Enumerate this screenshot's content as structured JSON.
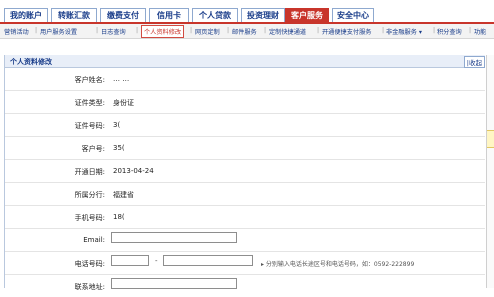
{
  "tabs": [
    {
      "label": "我的账户",
      "active": false
    },
    {
      "label": "转账汇款",
      "active": false
    },
    {
      "label": "缴费支付",
      "active": false
    },
    {
      "label": "信用卡",
      "active": false
    },
    {
      "label": "个人贷款",
      "active": false
    },
    {
      "label": "投资理财",
      "active": false
    },
    {
      "label": "客户服务",
      "active": true
    },
    {
      "label": "安全中心",
      "active": false
    }
  ],
  "subnav": [
    {
      "label": "营销活动",
      "active": false
    },
    {
      "label": "用户服务设置",
      "active": false
    },
    {
      "label": "日志查询",
      "active": false
    },
    {
      "label": "个人资料修改",
      "active": true
    },
    {
      "label": "网页定制",
      "active": false
    },
    {
      "label": "邮件服务",
      "active": false
    },
    {
      "label": "定制快捷通道",
      "active": false
    },
    {
      "label": "开通便捷支付服务",
      "active": false
    },
    {
      "label": "非金融服务 ▾",
      "active": false
    },
    {
      "label": "积分查询",
      "active": false
    },
    {
      "label": "功能",
      "active": false
    }
  ],
  "panel": {
    "title": "个人资料修改",
    "retract_label": "|收起",
    "fields": {
      "customer_name": {
        "label": "客户姓名:",
        "value": "… …"
      },
      "id_type": {
        "label": "证件类型:",
        "value": "身份证"
      },
      "id_number": {
        "label": "证件号码:",
        "value": "3("
      },
      "customer_no": {
        "label": "客户号:",
        "value": "35("
      },
      "open_date": {
        "label": "开通日期:",
        "value": "2013-04-24"
      },
      "branch": {
        "label": "所属分行:",
        "value": "福建省"
      },
      "mobile": {
        "label": "手机号码:",
        "value": "18("
      },
      "email": {
        "label": "Email:",
        "value": ""
      },
      "phone": {
        "label": "电话号码:",
        "area": "",
        "number": "",
        "dash": "-",
        "hint": "▸ 分别输入电话长途区号和电话号码，如：0592-222899"
      },
      "address": {
        "label": "联系地址:",
        "value": ""
      }
    }
  }
}
